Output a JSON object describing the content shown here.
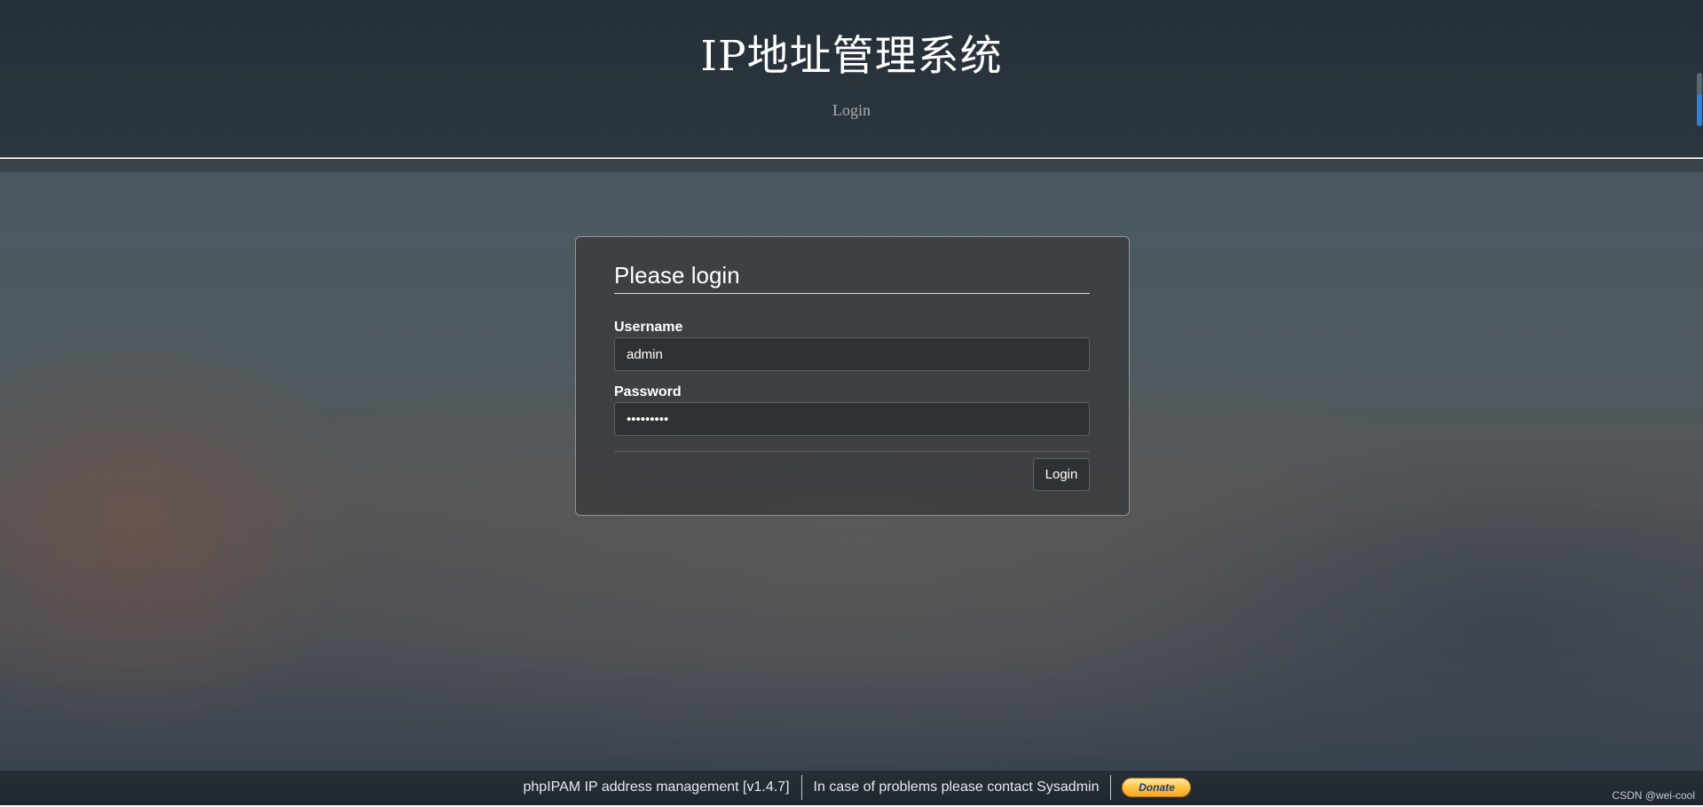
{
  "header": {
    "title": "IP地址管理系统",
    "subtitle": "Login"
  },
  "login": {
    "heading": "Please login",
    "username_label": "Username",
    "username_value": "admin",
    "password_label": "Password",
    "password_value": "123456789",
    "submit_label": "Login"
  },
  "footer": {
    "app_version": "phpIPAM IP address management [v1.4.7]",
    "contact": "In case of problems please contact Sysadmin",
    "donate_label": "Donate"
  },
  "watermark": "CSDN @wei-cool",
  "colors": {
    "header_bg": "#252f38",
    "footer_bg": "#1f262d",
    "donate_gold": "#ffc84a",
    "scroll_accent": "#2f7fd6"
  }
}
